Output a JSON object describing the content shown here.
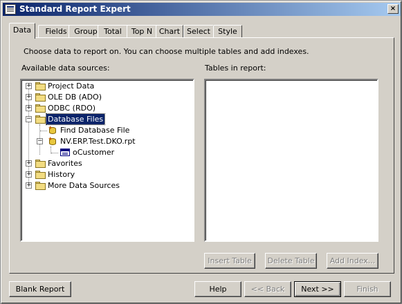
{
  "window": {
    "title": "Standard Report Expert",
    "close_glyph": "×"
  },
  "tabs": [
    {
      "label": "Data"
    },
    {
      "label": "Fields"
    },
    {
      "label": "Group"
    },
    {
      "label": "Total"
    },
    {
      "label": "Top N"
    },
    {
      "label": "Chart"
    },
    {
      "label": "Select"
    },
    {
      "label": "Style"
    }
  ],
  "active_tab": "Data",
  "instruction": "Choose data to report on. You can choose multiple tables and add indexes.",
  "available_label": "Available data sources:",
  "tables_label": "Tables in report:",
  "tree": {
    "project_data": "Project Data",
    "ole_db": "OLE DB (ADO)",
    "odbc": "ODBC (RDO)",
    "database_files": "Database Files",
    "find_database_file": "Find Database File",
    "rpt_file": "NV.ERP.Test.DKO.rpt",
    "ocustomer": "oCustomer",
    "favorites": "Favorites",
    "history": "History",
    "more_sources": "More Data Sources"
  },
  "tables_in_report": [],
  "buttons": {
    "insert_table": "Insert Table",
    "delete_table": "Delete Table",
    "add_index": "Add Index...",
    "blank_report": "Blank Report",
    "help": "Help",
    "back": "<< Back",
    "next": "Next >>",
    "finish": "Finish"
  },
  "colors": {
    "title_bar": "#0a246a",
    "selection": "#0a246a",
    "face": "#d4d0c8"
  }
}
